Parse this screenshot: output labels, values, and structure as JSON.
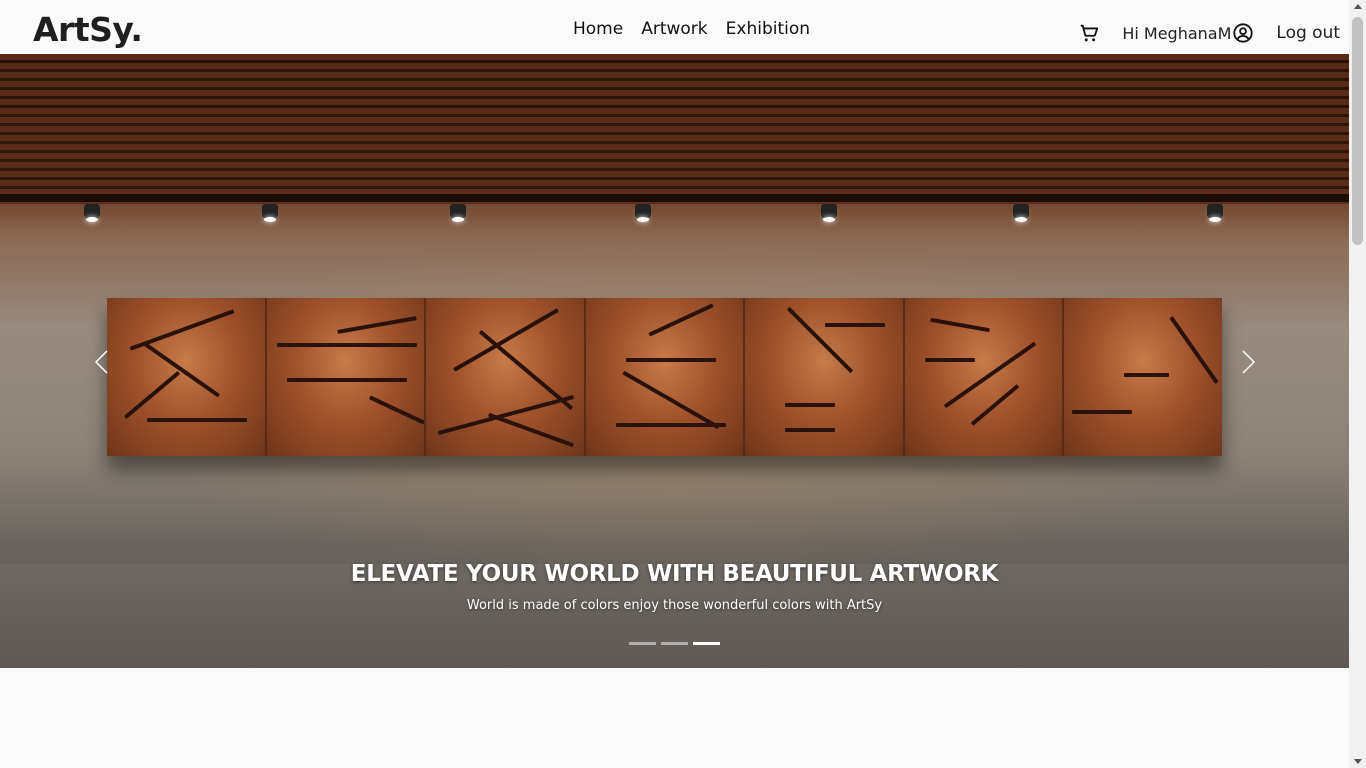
{
  "brand": "ArtSy.",
  "nav": {
    "links": [
      "Home",
      "Artwork",
      "Exhibition"
    ],
    "greeting": "Hi MeghanaM",
    "logout": "Log out"
  },
  "hero": {
    "title": "ELEVATE YOUR WORLD WITH BEAUTIFUL ARTWORK",
    "subtitle": "World is made of colors enjoy those wonderful colors with ArtSy",
    "slide_count": 3,
    "active_slide": 3
  },
  "icons": {
    "cart": "cart-icon",
    "user": "user-circle-icon",
    "prev": "chevron-left-icon",
    "next": "chevron-right-icon"
  },
  "colors": {
    "background": "#fafafa",
    "text": "#1a1a1a"
  }
}
